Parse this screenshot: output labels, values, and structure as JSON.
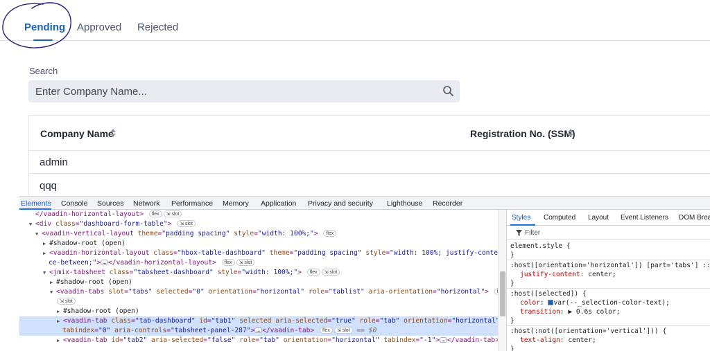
{
  "tabs": [
    {
      "label": "Pending",
      "selected": true
    },
    {
      "label": "Approved",
      "selected": false
    },
    {
      "label": "Rejected",
      "selected": false
    }
  ],
  "search": {
    "label": "Search",
    "placeholder": "Enter Company Name..."
  },
  "grid": {
    "columns": [
      "Company Name",
      "Registration No. (SSM)"
    ],
    "rows": [
      {
        "company": "admin"
      },
      {
        "company": "qqq"
      }
    ]
  },
  "devtools": {
    "tabs": [
      "Elements",
      "Console",
      "Sources",
      "Network",
      "Performance",
      "Memory",
      "Application",
      "Privacy and security",
      "Lighthouse",
      "Recorder"
    ],
    "selected_tab": "Elements",
    "badges": {
      "flex": "flex",
      "slot": "slot",
      "eq": "== $0"
    },
    "lines": {
      "l1": "</vaadin-horizontal-layout>",
      "l2_tag": "<div ",
      "l2_attr": "class",
      "l2_val": "\"dashboard-form-table\"",
      "l2_end": ">",
      "l3_tag": "<vaadin-vertical-layout ",
      "l3_a1": "theme",
      "l3_v1": "\"padding spacing\"",
      "l3_a2": "style",
      "l3_v2": "\"width: 100%;\"",
      "l3_end": ">",
      "l4": "#shadow-root (open)",
      "l5_tag": "<vaadin-horizontal-layout ",
      "l5_a1": "class",
      "l5_v1": "\"hbox-table-dashboard\"",
      "l5_a2": "theme",
      "l5_v2": "\"padding spacing\"",
      "l5_a3": "style",
      "l5_v3": "\"width: 100%; justify-content: spa",
      "l6_v": "ce-between;\"",
      "l6_end": ">",
      "l6_close": "</vaadin-horizontal-layout>",
      "l7_tag": "<jmix-tabsheet ",
      "l7_a1": "class",
      "l7_v1": "\"tabsheet-dashboard\"",
      "l7_a2": "style",
      "l7_v2": "\"width: 100%;\"",
      "l7_end": ">",
      "l8": "#shadow-root (open)",
      "l9_tag": "<vaadin-tabs ",
      "l9_a1": "slot",
      "l9_v1": "\"tabs\"",
      "l9_a2": "selected",
      "l9_v2": "\"0\"",
      "l9_a3": "orientation",
      "l9_v3": "\"horizontal\"",
      "l9_a4": "role",
      "l9_v4": "\"tablist\"",
      "l9_a5": "aria-orientation",
      "l9_v5": "\"horizontal\"",
      "l9_end": ">",
      "l11": "#shadow-root (open)",
      "l12_tag": "<vaadin-tab ",
      "l12_a1": "class",
      "l12_v1": "\"tab-dashboard\"",
      "l12_a2": "id",
      "l12_v2": "\"tab1\"",
      "l12_a3": "selected",
      "l12_a4": "aria-selected",
      "l12_v4": "\"true\"",
      "l12_a5": "role",
      "l12_v5": "\"tab\"",
      "l12_a6": "orientation",
      "l12_v6": "\"horizontal\"",
      "l13_a1": "tabindex",
      "l13_v1": "\"0\"",
      "l13_a2": "aria-controls",
      "l13_v2": "\"tabsheet-panel-287\"",
      "l13_end": ">",
      "l13_close": "</vaadin-tab>",
      "l14_tag": "<vaadin-tab ",
      "l14_a1": "id",
      "l14_v1": "\"tab2\"",
      "l14_a2": "aria-selected",
      "l14_v2": "\"false\"",
      "l14_a3": "role",
      "l14_v3": "\"tab\"",
      "l14_a4": "orientation",
      "l14_v4": "\"horizontal\"",
      "l14_a5": "tabindex",
      "l14_v5": "\"-1\"",
      "l14_end": ">",
      "l14_close": "</vaadin-tab>"
    },
    "styles": {
      "tabs": [
        "Styles",
        "Computed",
        "Layout",
        "Event Listeners",
        "DOM Brea"
      ],
      "filter_placeholder": "Filter",
      "r1_sel": "element.style {",
      "close": "}",
      "r2_sel": ":host([orientation='horizontal']) [part='tabs'] ::slo",
      "r2_p1": "justify-content",
      "r2_v1": "center;",
      "r3_sel": ":host([selected]) {",
      "r3_p1": "color",
      "r3_v1": "var(--_selection-color-text);",
      "r3_p2": "transition",
      "r3_v2": "0.6s color;",
      "r4_sel": ":host(:not([orientation='vertical'])) {",
      "r4_p1": "text-align",
      "r4_v1": "center;"
    }
  }
}
